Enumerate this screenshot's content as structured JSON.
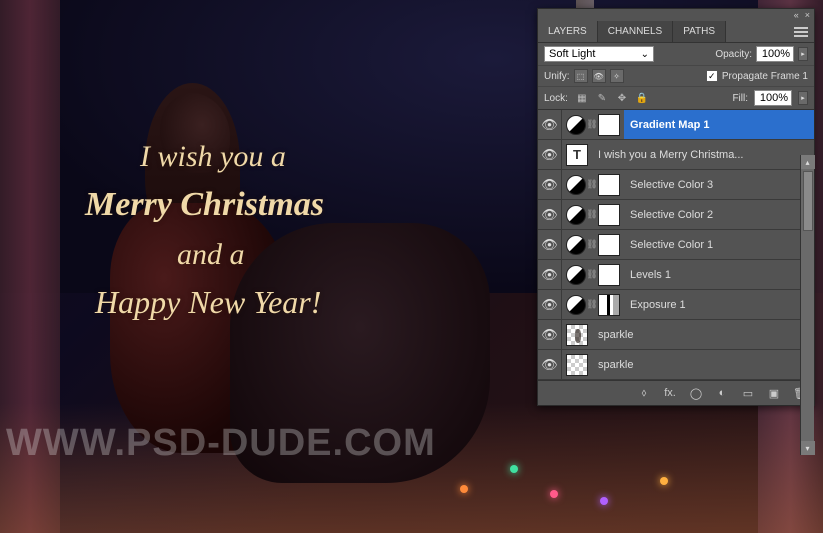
{
  "canvas_text": {
    "line1": "I wish you a",
    "line2": "Merry Christmas",
    "line3": "and a",
    "line4": "Happy New Year!",
    "watermark": "WWW.PSD-DUDE.COM"
  },
  "panel": {
    "top_collapse": "«",
    "top_close": "×",
    "tabs": {
      "layers": "LAYERS",
      "channels": "CHANNELS",
      "paths": "PATHS"
    },
    "blend_mode": "Soft Light",
    "opacity_label": "Opacity:",
    "opacity_value": "100%",
    "unify_label": "Unify:",
    "propagate_label": "Propagate Frame 1",
    "propagate_checked": "✓",
    "lock_label": "Lock:",
    "fill_label": "Fill:",
    "fill_value": "100%",
    "layers": [
      {
        "name": "Gradient Map 1",
        "type": "adj",
        "mask": "white",
        "selected": true
      },
      {
        "name": "I wish you a Merry Christma...",
        "type": "type",
        "mask": "",
        "selected": false
      },
      {
        "name": "Selective Color 3",
        "type": "adj",
        "mask": "white",
        "selected": false
      },
      {
        "name": "Selective Color 2",
        "type": "adj",
        "mask": "white",
        "selected": false
      },
      {
        "name": "Selective Color 1",
        "type": "adj",
        "mask": "white",
        "selected": false
      },
      {
        "name": "Levels 1",
        "type": "adj",
        "mask": "white",
        "selected": false
      },
      {
        "name": "Exposure 1",
        "type": "adj",
        "mask": "mix",
        "selected": false
      },
      {
        "name": "sparkle",
        "type": "sparkle",
        "mask": "",
        "selected": false
      },
      {
        "name": "sparkle",
        "type": "checker",
        "mask": "",
        "selected": false
      }
    ],
    "footer_icons": {
      "link": "⬨",
      "fx": "fx.",
      "mask": "◯",
      "adj": "◐",
      "folder": "▭",
      "new": "▣",
      "trash": "🗑"
    }
  }
}
